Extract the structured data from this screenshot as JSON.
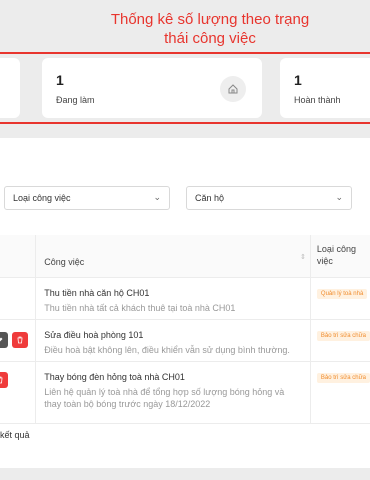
{
  "annotation": "Thống kê số lượng theo trạng\nthái công việc",
  "stats": [
    {
      "value": "1",
      "label": "Đang làm",
      "icon": "home-icon"
    },
    {
      "value": "1",
      "label": "Hoàn thành",
      "icon": "home-icon"
    }
  ],
  "filters": {
    "task_type": "Loại công việc",
    "apartment": "Căn hộ"
  },
  "table": {
    "headers": {
      "task": "Công việc",
      "type": "Loại công\nviệc"
    },
    "rows": [
      {
        "title": "Thu tiền nhà căn hộ CH01",
        "desc": "Thu tiền nhà tất cả khách thuê tại toà nhà CH01",
        "type": "Quản lý toà nhà"
      },
      {
        "title": "Sửa điều hoà phòng 101",
        "desc": "Điều hoà bật không lên, điều khiển vẫn sử dụng bình thường.",
        "type": "Bảo trì sửa chữa"
      },
      {
        "title": "Thay bóng đèn hỏng toà nhà CH01",
        "desc": "Liên hệ quản lý toà nhà để tổng hợp số lượng bóng hỏng và thay toàn bộ bóng trước ngày 18/12/2022",
        "type": "Bảo trì sửa chữa"
      }
    ]
  },
  "footer_text": "kết quả",
  "colors": {
    "annotation": "#e8352e",
    "tag_bg": "#fff1e0",
    "tag_text": "#f08c2d",
    "delete": "#ef3b3b"
  }
}
